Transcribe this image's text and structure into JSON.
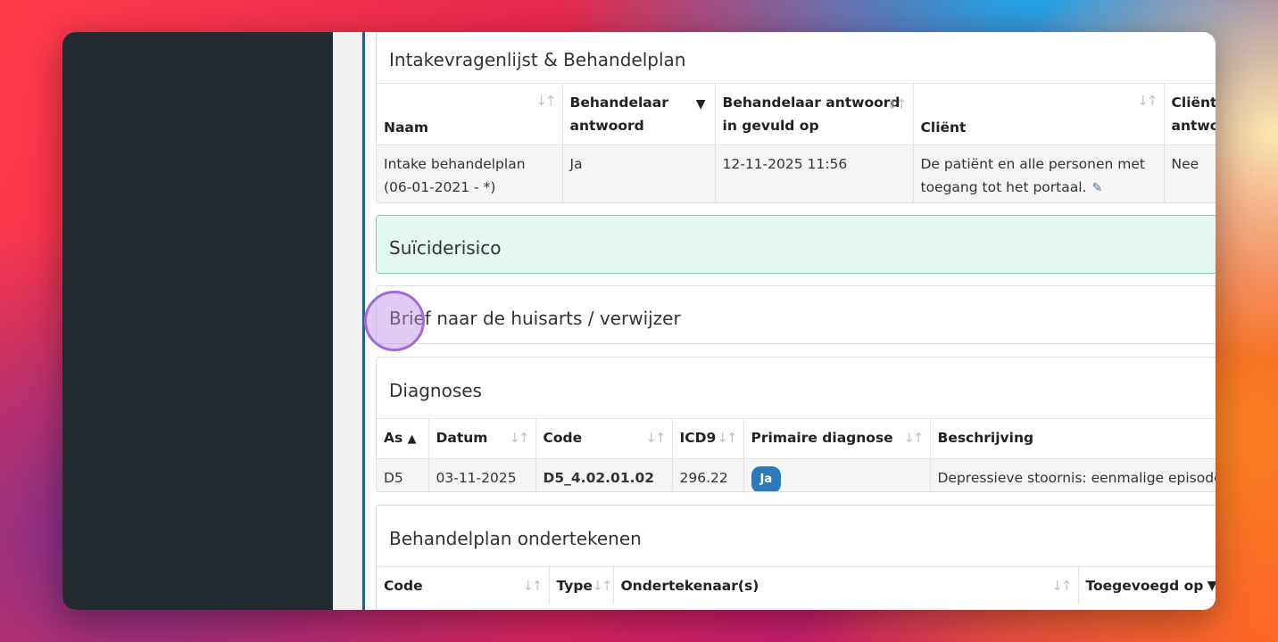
{
  "intake": {
    "title": "Intakevragenlijst & Behandelplan",
    "columns": [
      "Naam",
      "Behandelaar antwoord",
      "Behandelaar antwoord in gevuld op",
      "Cliënt",
      "Cliënt antwoord"
    ],
    "row": {
      "naam": "Intake behandelplan (06-01-2021 - *)",
      "behandelaar_antwoord": "Ja",
      "ingevuld_op": "12-11-2025 11:56",
      "client": "De patiënt en alle personen met toegang tot het portaal.",
      "client_antwoord": "Nee"
    }
  },
  "suicide": {
    "title": "Suïciderisico"
  },
  "brief": {
    "title": "Brief naar de huisarts / verwijzer"
  },
  "diagnoses": {
    "title": "Diagnoses",
    "columns": [
      "As",
      "Datum",
      "Code",
      "ICD9",
      "Primaire diagnose",
      "Beschrijving"
    ],
    "row": {
      "as": "D5",
      "datum": "03-11-2025",
      "code": "D5_4.02.01.02",
      "icd9": "296.22",
      "primaire": "Ja",
      "beschrijving": "Depressieve stoornis: eenmalige episode"
    }
  },
  "sign": {
    "title": "Behandelplan ondertekenen",
    "columns": [
      "Code",
      "Type",
      "Ondertekenaar(s)",
      "Toegevoegd op"
    ]
  },
  "colors": {
    "sidebar": "#222b30",
    "success_bg": "#e3f9ef",
    "badge": "#2e7ab8",
    "rail": "#2b5d80"
  }
}
